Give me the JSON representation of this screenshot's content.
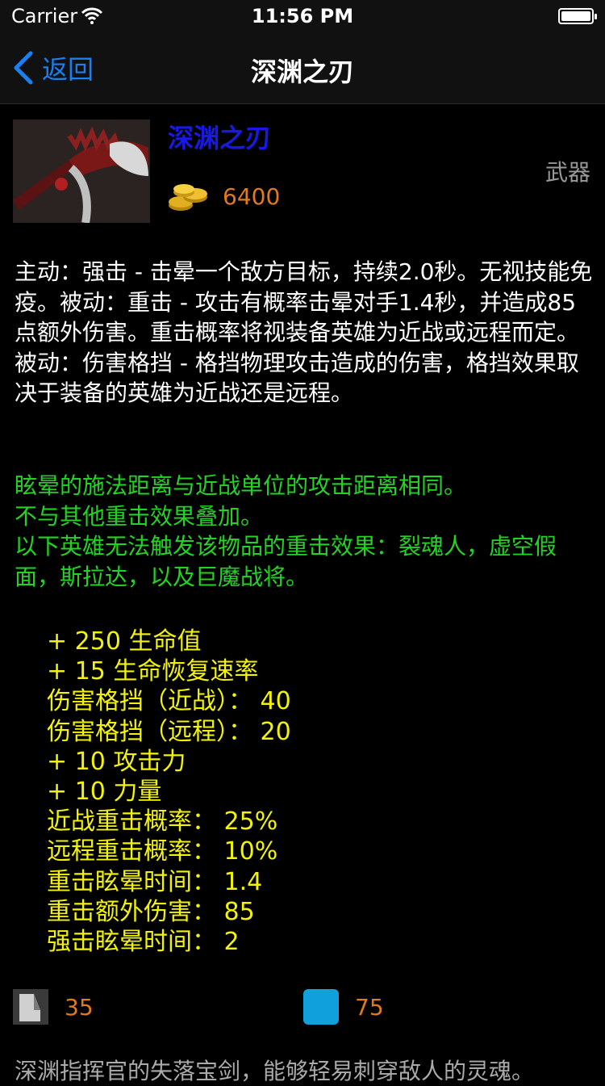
{
  "status_bar": {
    "carrier": "Carrier",
    "time": "11:56 PM"
  },
  "nav": {
    "back_label": "返回",
    "title": "深渊之刃"
  },
  "item": {
    "name": "深渊之刃",
    "type": "武器",
    "cost": "6400",
    "name_color": "#1919e6",
    "cost_color": "#e07a1f"
  },
  "description": [
    "主动：强击 - 击晕一个敌方目标，持续2.0秒。无视技能免疫。被动：重击 - 攻击有概率击晕对手1.4秒，并造成85点额外伤害。重击概率将视装备英雄为近战或远程而定。",
    "被动：伤害格挡 - 格挡物理攻击造成的伤害，格挡效果取决于装备的英雄为近战还是远程。"
  ],
  "notes": [
    "眩晕的施法距离与近战单位的攻击距离相同。",
    "不与其他重击效果叠加。",
    "以下英雄无法触发该物品的重击效果：裂魂人，虚空假面，斯拉达，以及巨魔战将。"
  ],
  "stats": [
    "+ 250 生命值",
    "+ 15 生命恢复速率",
    "伤害格挡（近战）： 40",
    "伤害格挡（远程）： 20",
    "+ 10 攻击力",
    "+ 10 力量",
    "近战重击概率： 25%",
    "远程重击概率： 10%",
    "重击眩晕时间： 1.4",
    "重击额外伤害： 85",
    "强击眩晕时间： 2"
  ],
  "abilities": {
    "cooldown": "35",
    "mana": "75"
  },
  "lore": "深渊指挥官的失落宝剑，能够轻易刺穿敌人的灵魂。",
  "colors": {
    "accent": "#1a7ff0",
    "notes": "#22d422",
    "stats": "#f2f20a",
    "mana_icon": "#10a0dc"
  }
}
